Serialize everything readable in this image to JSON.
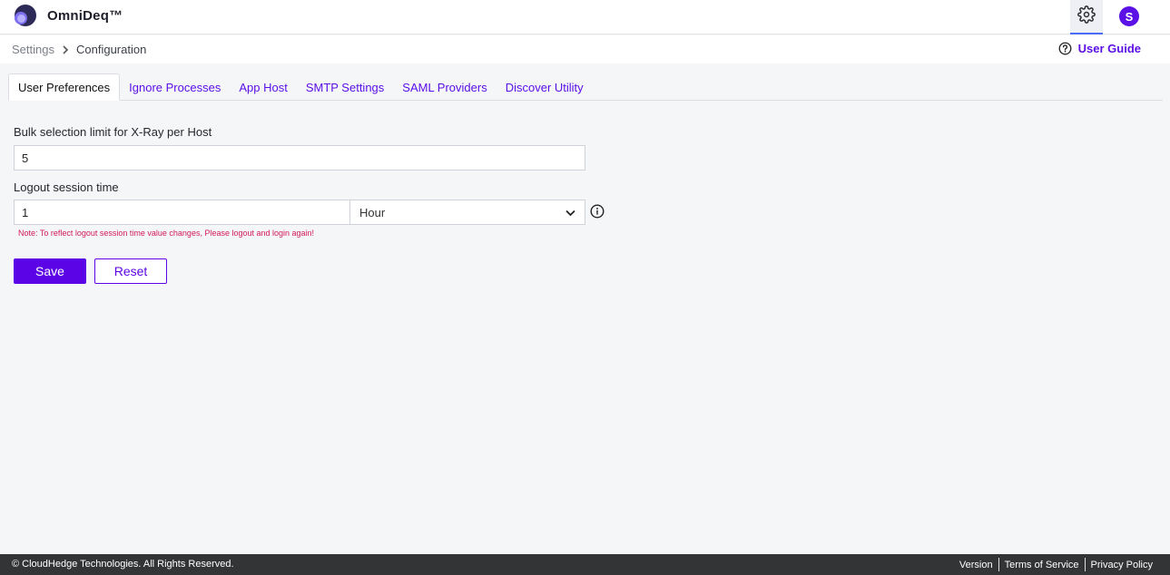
{
  "app": {
    "name": "OmniDeq™",
    "user_initial": "S"
  },
  "breadcrumb": {
    "root": "Settings",
    "current": "Configuration"
  },
  "help": {
    "user_guide_label": "User Guide"
  },
  "tabs": [
    {
      "label": "User Preferences",
      "active": true
    },
    {
      "label": "Ignore Processes",
      "active": false
    },
    {
      "label": "App Host",
      "active": false
    },
    {
      "label": "SMTP Settings",
      "active": false
    },
    {
      "label": "SAML Providers",
      "active": false
    },
    {
      "label": "Discover Utility",
      "active": false
    }
  ],
  "form": {
    "bulk_label": "Bulk selection limit for X-Ray per Host",
    "bulk_value": "5",
    "logout_label": "Logout session time",
    "logout_value": "1",
    "logout_unit": "Hour",
    "note": "Note: To reflect logout session time value changes, Please logout and login again!",
    "save_label": "Save",
    "reset_label": "Reset"
  },
  "footer": {
    "copyright": "© CloudHedge Technologies. All Rights Reserved.",
    "links": [
      "Version",
      "Terms of Service",
      "Privacy Policy"
    ]
  },
  "colors": {
    "accent": "#5b05e6",
    "note": "#d11a56",
    "footer_bg": "#333436"
  },
  "icons": {
    "settings": "gear-icon",
    "help": "question-circle-icon",
    "info": "info-circle-icon",
    "breadcrumb_sep": "chevron-right-icon",
    "select_caret": "chevron-down-icon"
  }
}
